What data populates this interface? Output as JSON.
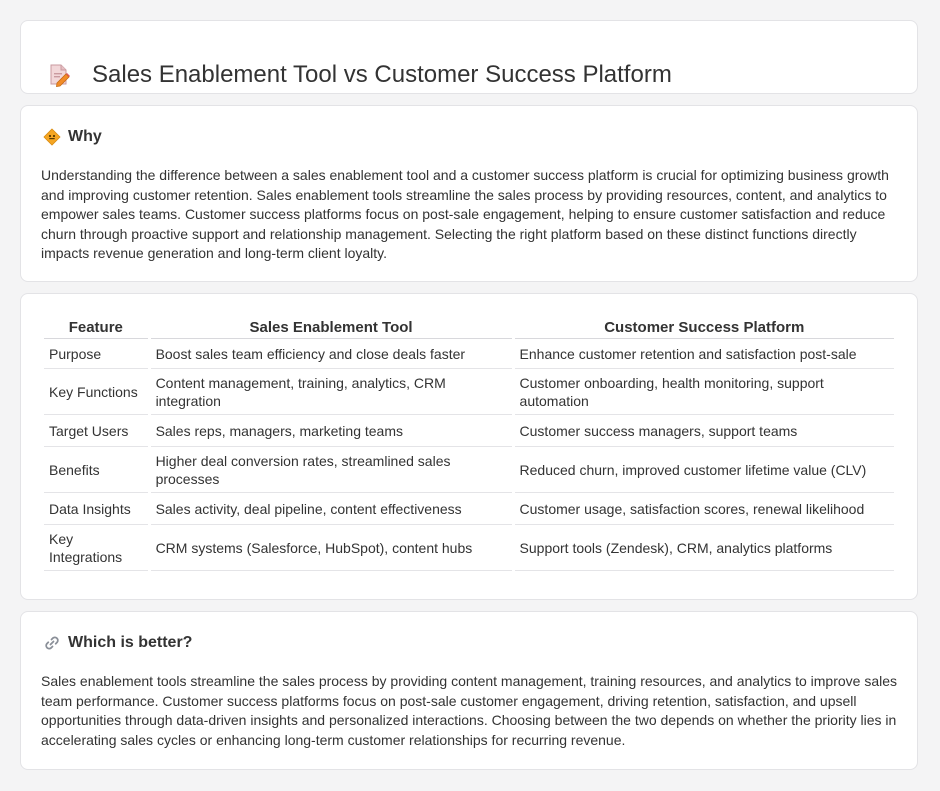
{
  "header": {
    "title": "Sales Enablement Tool vs Customer Success Platform",
    "icon": "document-pencil-icon"
  },
  "why": {
    "heading": "Why",
    "icon": "diamond-sign-icon",
    "body": "Understanding the difference between a sales enablement tool and a customer success platform is crucial for optimizing business growth and improving customer retention. Sales enablement tools streamline the sales process by providing resources, content, and analytics to empower sales teams. Customer success platforms focus on post-sale engagement, helping to ensure customer satisfaction and reduce churn through proactive support and relationship management. Selecting the right platform based on these distinct functions directly impacts revenue generation and long-term client loyalty."
  },
  "table": {
    "headers": [
      "Feature",
      "Sales Enablement Tool",
      "Customer Success Platform"
    ],
    "rows": [
      [
        "Purpose",
        "Boost sales team efficiency and close deals faster",
        "Enhance customer retention and satisfaction post-sale"
      ],
      [
        "Key Functions",
        "Content management, training, analytics, CRM integration",
        "Customer onboarding, health monitoring, support automation"
      ],
      [
        "Target Users",
        "Sales reps, managers, marketing teams",
        "Customer success managers, support teams"
      ],
      [
        "Benefits",
        "Higher deal conversion rates, streamlined sales processes",
        "Reduced churn, improved customer lifetime value (CLV)"
      ],
      [
        "Data Insights",
        "Sales activity, deal pipeline, content effectiveness",
        "Customer usage, satisfaction scores, renewal likelihood"
      ],
      [
        "Key Integrations",
        "CRM systems (Salesforce, HubSpot), content hubs",
        "Support tools (Zendesk), CRM, analytics platforms"
      ]
    ]
  },
  "better": {
    "heading": "Which is better?",
    "icon": "link-icon",
    "body": "Sales enablement tools streamline the sales process by providing content management, training resources, and analytics to improve sales team performance. Customer success platforms focus on post-sale customer engagement, driving retention, satisfaction, and upsell opportunities through data-driven insights and personalized interactions. Choosing between the two depends on whether the priority lies in accelerating sales cycles or enhancing long-term customer relationships for recurring revenue."
  }
}
